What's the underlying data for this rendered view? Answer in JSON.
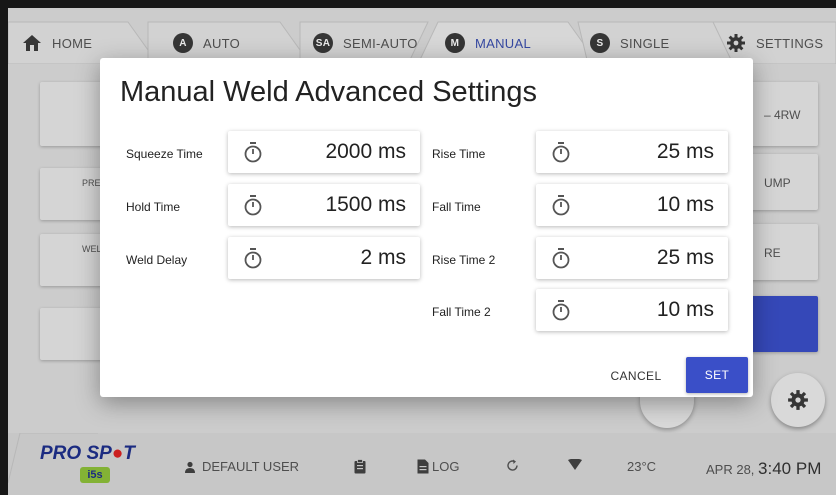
{
  "tabs": [
    {
      "label": "HOME",
      "icon": "home-icon",
      "badge": ""
    },
    {
      "label": "AUTO",
      "icon": "auto-icon",
      "badge": "A"
    },
    {
      "label": "SEMI-AUTO",
      "icon": "semi-auto-icon",
      "badge": "SA"
    },
    {
      "label": "MANUAL",
      "icon": "manual-icon",
      "badge": "M"
    },
    {
      "label": "SINGLE",
      "icon": "single-icon",
      "badge": "S"
    },
    {
      "label": "SETTINGS",
      "icon": "gear-icon",
      "badge": ""
    }
  ],
  "active_tab": "MANUAL",
  "background": {
    "right_labels": [
      "– 4RW",
      "UMP",
      "RE"
    ],
    "left_labels": [
      "PRE",
      "WEL"
    ]
  },
  "dialog": {
    "title": "Manual Weld Advanced Settings",
    "left_fields": [
      {
        "label": "Squeeze Time",
        "value": "2000 ms"
      },
      {
        "label": "Hold Time",
        "value": "1500 ms"
      },
      {
        "label": "Weld Delay",
        "value": "2 ms"
      }
    ],
    "right_fields": [
      {
        "label": "Rise Time",
        "value": "25 ms"
      },
      {
        "label": "Fall Time",
        "value": "10 ms"
      },
      {
        "label": "Rise Time 2",
        "value": "25 ms"
      },
      {
        "label": "Fall Time 2",
        "value": "10 ms"
      }
    ],
    "cancel_label": "CANCEL",
    "set_label": "SET"
  },
  "bottom_bar": {
    "logo_text": "PRO SP",
    "logo_suffix": "T",
    "logo_sub": "i5s",
    "user": "DEFAULT USER",
    "log": "LOG",
    "temperature": "23°C",
    "date": "APR 28,",
    "time": "3:40 PM"
  },
  "colors": {
    "accent": "#3a4fc8",
    "active_tab": "#3a4fb0",
    "logo": "#1e2f8c",
    "logo_dot": "#d22"
  }
}
